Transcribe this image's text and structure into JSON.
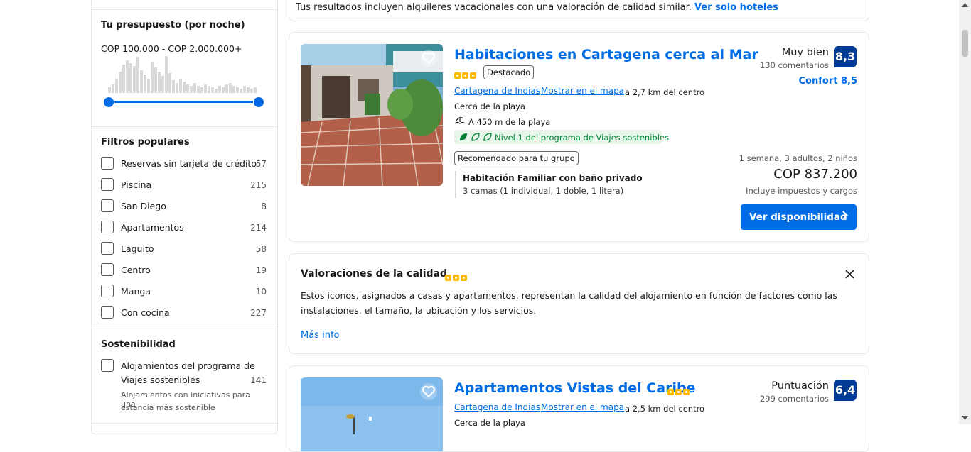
{
  "sidebar": {
    "budget": {
      "title": "Tu presupuesto (por noche)",
      "range": "COP 100.000 - COP 2.000.000+"
    },
    "popular": {
      "title": "Filtros populares",
      "items": [
        {
          "label": "Reservas sin tarjeta de crédito",
          "count": "57"
        },
        {
          "label": "Piscina",
          "count": "215"
        },
        {
          "label": "San Diego",
          "count": "8"
        },
        {
          "label": "Apartamentos",
          "count": "214"
        },
        {
          "label": "Laguito",
          "count": "58"
        },
        {
          "label": "Centro",
          "count": "19"
        },
        {
          "label": "Manga",
          "count": "10"
        },
        {
          "label": "Con cocina",
          "count": "227"
        }
      ]
    },
    "sustainability": {
      "title": "Sostenibilidad",
      "item_label_1": "Alojamientos del programa de",
      "item_label_2": "Viajes sostenibles",
      "item_count": "141",
      "desc_1": "Alojamientos con iniciativas para una",
      "desc_2": "estancia más sostenible"
    }
  },
  "banner": {
    "text": "Tus resultados incluyen alquileres vacacionales con una valoración de calidad similar.",
    "link": "Ver solo hoteles"
  },
  "result1": {
    "name": "Habitaciones en Cartagena cerca al Mar",
    "badge": "Destacado",
    "city": "Cartagena de Indias",
    "map": "Mostrar en el mapa",
    "distance": "a 2,7 km del centro",
    "beach_near": "Cerca de la playa",
    "beach_dist": "A 450 m de la playa",
    "sustainable": "Nivel 1 del programa de Viajes sostenibles",
    "recommended": "Recomendado para tu grupo",
    "room_name": "Habitación Familiar con baño privado",
    "beds": "3 camas (1 individual, 1 doble, 1 litera)",
    "score_word": "Muy bien",
    "reviews": "130 comentarios",
    "score": "8,3",
    "comfort": "Confort 8,5",
    "stay": "1 semana, 3 adultos, 2 niños",
    "price": "COP 837.200",
    "taxes": "Incluye impuestos y cargos",
    "button": "Ver disponibilidad"
  },
  "quality": {
    "title": "Valoraciones de la calidad",
    "line1": "Estos iconos, asignados a casas y apartamentos, representan la calidad del alojamiento en función de factores como las",
    "line2": "instalaciones, el tamaño, la ubicación y los servicios.",
    "more": "Más info"
  },
  "result2": {
    "name": "Apartamentos Vistas del Caribe",
    "city": "Cartagena de Indias",
    "map": "Mostrar en el mapa",
    "distance": "a 2,5 km del centro",
    "beach_near": "Cerca de la playa",
    "score_word": "Puntuación",
    "reviews": "299 comentarios",
    "score": "6,4"
  },
  "colors": {
    "accent": "#006ce4",
    "score_bg": "#003b95",
    "star": "#febb02",
    "sustainable": "#008234"
  }
}
